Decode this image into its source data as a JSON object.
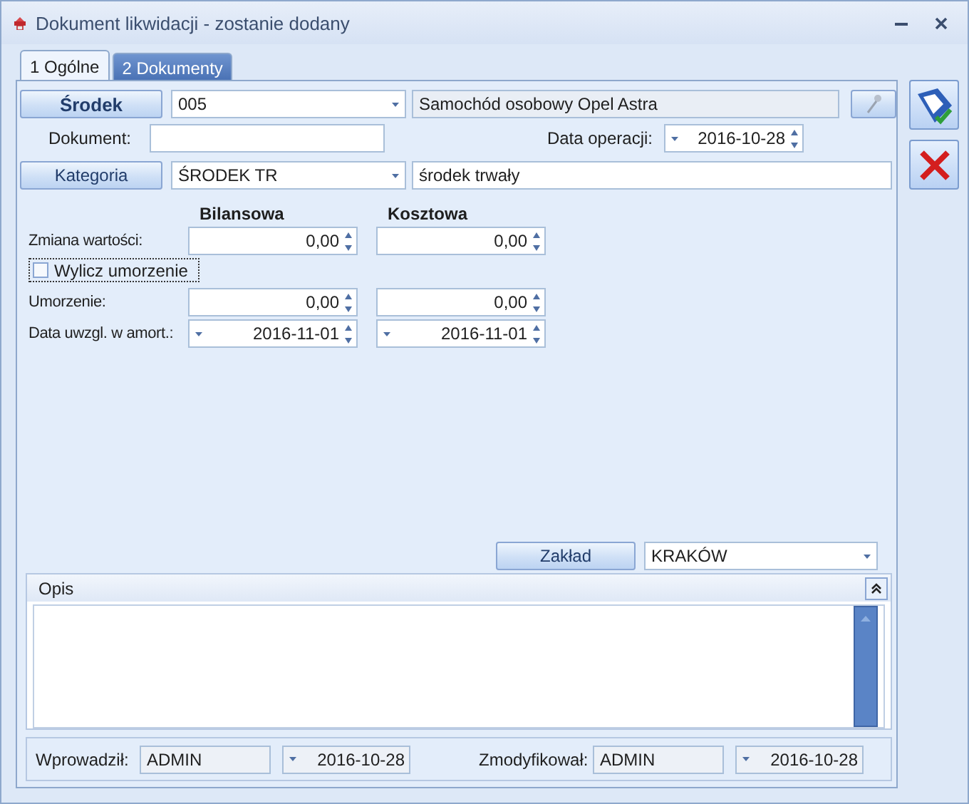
{
  "window": {
    "title": "Dokument likwidacji - zostanie dodany"
  },
  "tabs": [
    {
      "label": "1 Ogólne",
      "selected": true
    },
    {
      "label": "2 Dokumenty",
      "selected": false
    }
  ],
  "asset": {
    "button": "Środek",
    "code": "005",
    "name": "Samochód osobowy Opel Astra"
  },
  "document": {
    "label": "Dokument:"
  },
  "operation_date": {
    "label": "Data operacji:",
    "value": "2016-10-28"
  },
  "category": {
    "button": "Kategoria",
    "code": "ŚRODEK TR",
    "name": "środek trwały"
  },
  "columns": [
    "Bilansowa",
    "Kosztowa"
  ],
  "rows": [
    {
      "kind": "number",
      "label": "Zmiana wartości:",
      "values": [
        "0,00",
        "0,00"
      ]
    },
    {
      "kind": "checkbox",
      "label": "Wylicz umorzenie",
      "checked": false
    },
    {
      "kind": "number",
      "label": "Umorzenie:",
      "values": [
        "0,00",
        "0,00"
      ]
    },
    {
      "kind": "date",
      "label": "Data uwzgl. w amort.:",
      "values": [
        "2016-11-01",
        "2016-11-01"
      ]
    }
  ],
  "branch": {
    "button": "Zakład",
    "value": "KRAKÓW"
  },
  "description": {
    "title": "Opis"
  },
  "footer": [
    {
      "label": "Wprowadził:",
      "user": "ADMIN",
      "date": "2016-10-28"
    },
    {
      "label": "Zmodyfikował:",
      "user": "ADMIN",
      "date": "2016-10-28"
    }
  ]
}
